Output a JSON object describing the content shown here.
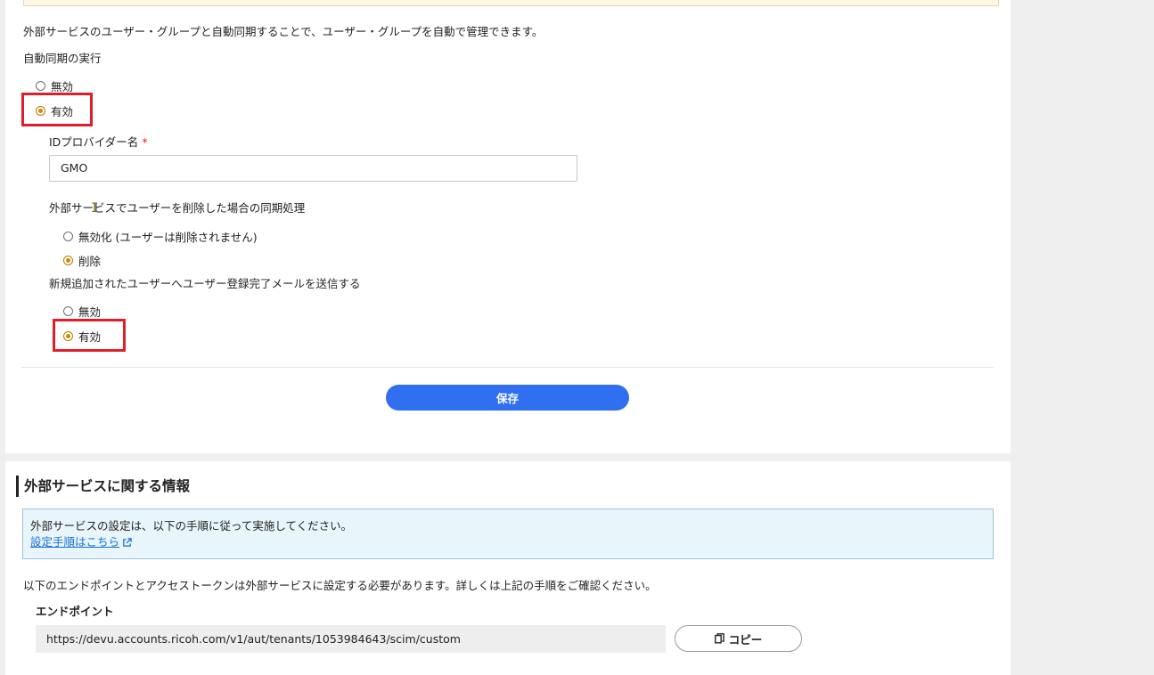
{
  "sync_section": {
    "description": "外部サービスのユーザー・グループと自動同期することで、ユーザー・グループを自動で管理できます。",
    "auto_sync_label": "自動同期の実行",
    "auto_sync_options": [
      {
        "label": "無効",
        "selected": false
      },
      {
        "label": "有効",
        "selected": true
      }
    ],
    "idp_name_label": "IDプロバイダー名",
    "required_mark": "*",
    "idp_name_value": "GMO",
    "delete_sync_label": "外部サービスでユーザーを削除した場合の同期処理",
    "delete_sync_options": [
      {
        "label": "無効化 (ユーザーは削除されません)",
        "selected": false
      },
      {
        "label": "削除",
        "selected": true
      }
    ],
    "mail_label": "新規追加されたユーザーへユーザー登録完了メールを送信する",
    "mail_options": [
      {
        "label": "無効",
        "selected": false
      },
      {
        "label": "有効",
        "selected": true
      }
    ],
    "save_label": "保存"
  },
  "info_section": {
    "title": "外部サービスに関する情報",
    "notice_text": "外部サービスの設定は、以下の手順に従って実施してください。",
    "notice_link": "設定手順はこちら",
    "endpoint_description": "以下のエンドポイントとアクセストークンは外部サービスに設定する必要があります。詳しくは上記の手順をご確認ください。",
    "endpoint_label": "エンドポイント",
    "endpoint_value": "https://devu.accounts.ricoh.com/v1/aut/tenants/1053984643/scim/custom",
    "copy_label": "コピー"
  },
  "colors": {
    "accent_blue": "#2f6ff0",
    "radio_selected": "#d48a00",
    "highlight_red": "#e01e2b",
    "info_bg": "#e8f5fb"
  }
}
